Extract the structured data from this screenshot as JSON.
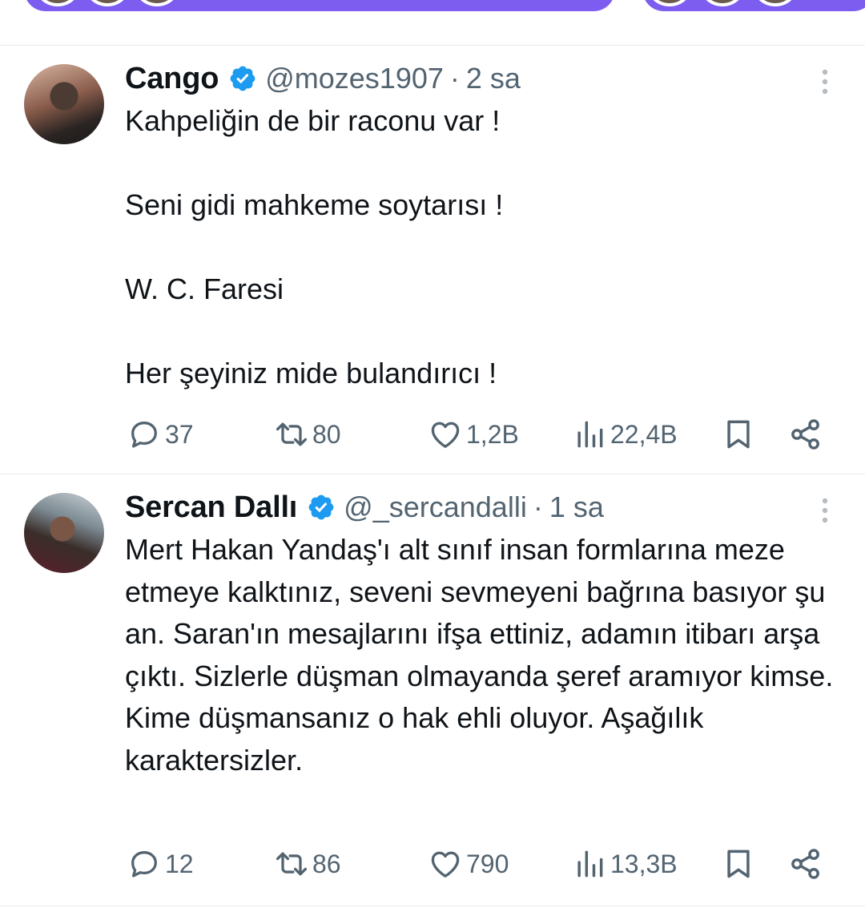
{
  "colors": {
    "verified": "#1d9bf0",
    "text_primary": "#0f1419",
    "text_secondary": "#536471",
    "divider": "#e6e9ec",
    "top_pill": "#7d5df0"
  },
  "icons": {
    "verified": "verified-badge-icon",
    "more": "more-vertical-icon",
    "reply": "reply-bubble-icon",
    "retweet": "retweet-icon",
    "like": "heart-icon",
    "views": "views-bar-chart-icon",
    "bookmark": "bookmark-icon",
    "share": "share-icon"
  },
  "tweets": [
    {
      "display_name": "Cango",
      "handle": "@mozes1907",
      "separator": "·",
      "time": "2 sa",
      "verified": true,
      "paragraphs": [
        "Kahpeliğin de bir raconu var !",
        "Seni gidi mahkeme soytarısı !",
        "W. C. Faresi",
        "Her şeyiniz mide bulandırıcı !"
      ],
      "stats": {
        "replies": "37",
        "retweets": "80",
        "likes": "1,2B",
        "views": "22,4B"
      }
    },
    {
      "display_name": "Sercan Dallı",
      "handle": "@_sercandalli",
      "separator": "·",
      "time": "1 sa",
      "verified": true,
      "text": "Mert Hakan Yandaş'ı alt sınıf insan formlarına meze etmeye kalktınız, seveni sevmeyeni bağrına basıyor şu an. Saran'ın mesajlarını ifşa ettiniz, adamın itibarı arşa çıktı. Sizlerle düşman olmayanda şeref aramıyor kimse. Kime düşmansanız o hak ehli oluyor. Aşağılık karaktersizler.",
      "stats": {
        "replies": "12",
        "retweets": "86",
        "likes": "790",
        "views": "13,3B"
      }
    }
  ]
}
